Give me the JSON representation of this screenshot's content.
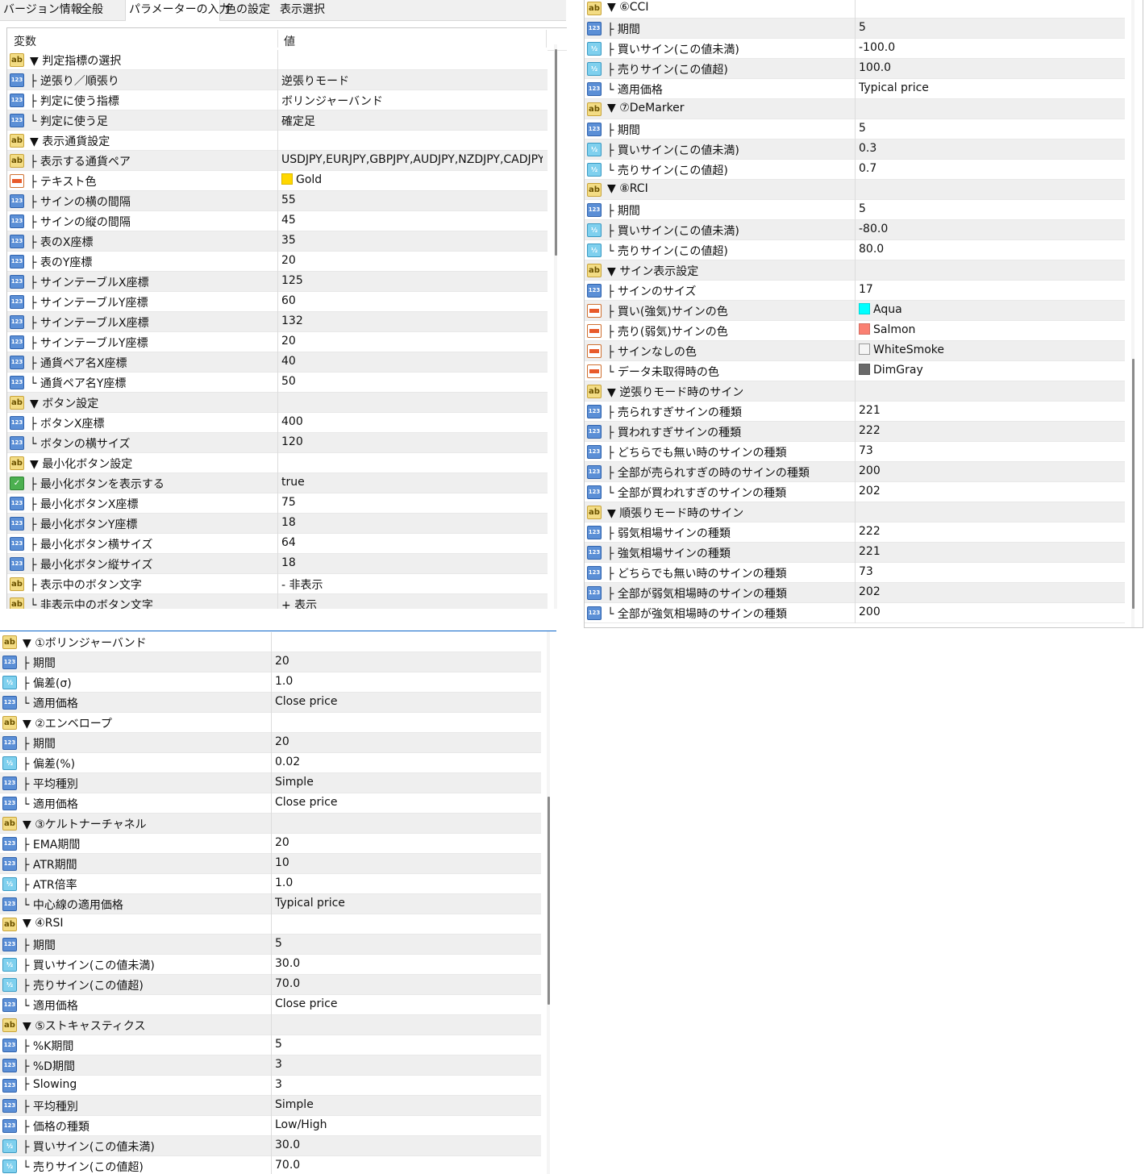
{
  "tabs": [
    {
      "label": "バージョン情報",
      "active": false
    },
    {
      "label": "全般",
      "active": false
    },
    {
      "label": "パラメーターの入力",
      "active": true
    },
    {
      "label": "色の設定",
      "active": false
    },
    {
      "label": "表示選択",
      "active": false
    }
  ],
  "header": {
    "col_name": "変数",
    "col_value": "値"
  },
  "colors": {
    "Gold": "#FFD700",
    "Aqua": "#00FFFF",
    "Salmon": "#FA8072",
    "WhiteSmoke": "#F5F5F5",
    "DimGray": "#696969"
  },
  "panel_top_left": [
    {
      "icon": "ab",
      "name": "▼ 判定指標の選択",
      "value": ""
    },
    {
      "icon": "123",
      "name": "├ 逆張り／順張り",
      "value": "逆張りモード"
    },
    {
      "icon": "123",
      "name": "├ 判定に使う指標",
      "value": "ボリンジャーバンド"
    },
    {
      "icon": "123",
      "name": "└ 判定に使う足",
      "value": "確定足"
    },
    {
      "icon": "ab",
      "name": "▼ 表示通貨設定",
      "value": ""
    },
    {
      "icon": "ab",
      "name": "├ 表示する通貨ペア",
      "value": "USDJPY,EURJPY,GBPJPY,AUDJPY,NZDJPY,CADJPY..."
    },
    {
      "icon": "clr",
      "name": "├ テキスト色",
      "value": "Gold",
      "swatch": "Gold"
    },
    {
      "icon": "123",
      "name": "├ サインの横の間隔",
      "value": "55"
    },
    {
      "icon": "123",
      "name": "├ サインの縦の間隔",
      "value": "45"
    },
    {
      "icon": "123",
      "name": "├ 表のX座標",
      "value": "35"
    },
    {
      "icon": "123",
      "name": "├ 表のY座標",
      "value": "20"
    },
    {
      "icon": "123",
      "name": "├ サインテーブルX座標",
      "value": "125"
    },
    {
      "icon": "123",
      "name": "├ サインテーブルY座標",
      "value": "60"
    },
    {
      "icon": "123",
      "name": "├ サインテーブルX座標",
      "value": "132"
    },
    {
      "icon": "123",
      "name": "├ サインテーブルY座標",
      "value": "20"
    },
    {
      "icon": "123",
      "name": "├ 通貨ペア名X座標",
      "value": "40"
    },
    {
      "icon": "123",
      "name": "└ 通貨ペア名Y座標",
      "value": "50"
    },
    {
      "icon": "ab",
      "name": "▼ ボタン設定",
      "value": ""
    },
    {
      "icon": "123",
      "name": "├ ボタンX座標",
      "value": "400"
    },
    {
      "icon": "123",
      "name": "└ ボタンの横サイズ",
      "value": "120"
    },
    {
      "icon": "ab",
      "name": "▼ 最小化ボタン設定",
      "value": ""
    },
    {
      "icon": "bool",
      "name": "├ 最小化ボタンを表示する",
      "value": "true"
    },
    {
      "icon": "123",
      "name": "├ 最小化ボタンX座標",
      "value": "75"
    },
    {
      "icon": "123",
      "name": "├ 最小化ボタンY座標",
      "value": "18"
    },
    {
      "icon": "123",
      "name": "├ 最小化ボタン横サイズ",
      "value": "64"
    },
    {
      "icon": "123",
      "name": "├ 最小化ボタン縦サイズ",
      "value": "18"
    },
    {
      "icon": "ab",
      "name": "├ 表示中のボタン文字",
      "value": "- 非表示"
    },
    {
      "icon": "ab",
      "name": "└ 非表示中のボタン文字",
      "value": "+ 表示"
    }
  ],
  "panel_bottom_left": [
    {
      "icon": "ab",
      "name": "▼ ①ボリンジャーバンド",
      "value": ""
    },
    {
      "icon": "123",
      "name": "├ 期間",
      "value": "20"
    },
    {
      "icon": "half",
      "name": "├ 偏差(σ)",
      "value": "1.0"
    },
    {
      "icon": "123",
      "name": "└ 適用価格",
      "value": "Close price"
    },
    {
      "icon": "ab",
      "name": "▼ ②エンベロープ",
      "value": ""
    },
    {
      "icon": "123",
      "name": "├ 期間",
      "value": "20"
    },
    {
      "icon": "half",
      "name": "├ 偏差(%)",
      "value": "0.02"
    },
    {
      "icon": "123",
      "name": "├ 平均種別",
      "value": "Simple"
    },
    {
      "icon": "123",
      "name": "└ 適用価格",
      "value": "Close price"
    },
    {
      "icon": "ab",
      "name": "▼ ③ケルトナーチャネル",
      "value": ""
    },
    {
      "icon": "123",
      "name": "├ EMA期間",
      "value": "20"
    },
    {
      "icon": "123",
      "name": "├ ATR期間",
      "value": "10"
    },
    {
      "icon": "half",
      "name": "├ ATR倍率",
      "value": "1.0"
    },
    {
      "icon": "123",
      "name": "└ 中心線の適用価格",
      "value": "Typical price"
    },
    {
      "icon": "ab",
      "name": "▼ ④RSI",
      "value": ""
    },
    {
      "icon": "123",
      "name": "├ 期間",
      "value": "5"
    },
    {
      "icon": "half",
      "name": "├ 買いサイン(この値未満)",
      "value": "30.0"
    },
    {
      "icon": "half",
      "name": "├ 売りサイン(この値超)",
      "value": "70.0"
    },
    {
      "icon": "123",
      "name": "└ 適用価格",
      "value": "Close price"
    },
    {
      "icon": "ab",
      "name": "▼ ⑤ストキャスティクス",
      "value": ""
    },
    {
      "icon": "123",
      "name": "├ %K期間",
      "value": "5"
    },
    {
      "icon": "123",
      "name": "├ %D期間",
      "value": "3"
    },
    {
      "icon": "123",
      "name": "├ Slowing",
      "value": "3"
    },
    {
      "icon": "123",
      "name": "├ 平均種別",
      "value": "Simple"
    },
    {
      "icon": "123",
      "name": "├ 価格の種類",
      "value": "Low/High"
    },
    {
      "icon": "half",
      "name": "├ 買いサイン(この値未満)",
      "value": "30.0"
    },
    {
      "icon": "half",
      "name": "└ 売りサイン(この値超)",
      "value": "70.0"
    }
  ],
  "panel_top_right": [
    {
      "icon": "ab",
      "name": "▼ ⑥CCI",
      "value": ""
    },
    {
      "icon": "123",
      "name": "├ 期間",
      "value": "5"
    },
    {
      "icon": "half",
      "name": "├ 買いサイン(この値未満)",
      "value": "-100.0"
    },
    {
      "icon": "half",
      "name": "├ 売りサイン(この値超)",
      "value": "100.0"
    },
    {
      "icon": "123",
      "name": "└ 適用価格",
      "value": "Typical price"
    },
    {
      "icon": "ab",
      "name": "▼ ⑦DeMarker",
      "value": ""
    },
    {
      "icon": "123",
      "name": "├ 期間",
      "value": "5"
    },
    {
      "icon": "half",
      "name": "├ 買いサイン(この値未満)",
      "value": "0.3"
    },
    {
      "icon": "half",
      "name": "└ 売りサイン(この値超)",
      "value": "0.7"
    },
    {
      "icon": "ab",
      "name": "▼ ⑧RCI",
      "value": ""
    },
    {
      "icon": "123",
      "name": "├ 期間",
      "value": "5"
    },
    {
      "icon": "half",
      "name": "├ 買いサイン(この値未満)",
      "value": "-80.0"
    },
    {
      "icon": "half",
      "name": "└ 売りサイン(この値超)",
      "value": "80.0"
    },
    {
      "icon": "ab",
      "name": "▼ サイン表示設定",
      "value": ""
    },
    {
      "icon": "123",
      "name": "├ サインのサイズ",
      "value": "17"
    },
    {
      "icon": "clr",
      "name": "├ 買い(強気)サインの色",
      "value": "Aqua",
      "swatch": "Aqua"
    },
    {
      "icon": "clr",
      "name": "├ 売り(弱気)サインの色",
      "value": "Salmon",
      "swatch": "Salmon"
    },
    {
      "icon": "clr",
      "name": "├ サインなしの色",
      "value": "WhiteSmoke",
      "swatch": "WhiteSmoke"
    },
    {
      "icon": "clr",
      "name": "└ データ未取得時の色",
      "value": "DimGray",
      "swatch": "DimGray"
    },
    {
      "icon": "ab",
      "name": "▼ 逆張りモード時のサイン",
      "value": ""
    },
    {
      "icon": "123",
      "name": "├ 売られすぎサインの種類",
      "value": "221"
    },
    {
      "icon": "123",
      "name": "├ 買われすぎサインの種類",
      "value": "222"
    },
    {
      "icon": "123",
      "name": "├ どちらでも無い時のサインの種類",
      "value": "73"
    },
    {
      "icon": "123",
      "name": "├ 全部が売られすぎの時のサインの種類",
      "value": "200"
    },
    {
      "icon": "123",
      "name": "└ 全部が買われすぎのサインの種類",
      "value": "202"
    },
    {
      "icon": "ab",
      "name": "▼ 順張りモード時のサイン",
      "value": ""
    },
    {
      "icon": "123",
      "name": "├ 弱気相場サインの種類",
      "value": "222"
    },
    {
      "icon": "123",
      "name": "├ 強気相場サインの種類",
      "value": "221"
    },
    {
      "icon": "123",
      "name": "├ どちらでも無い時のサインの種類",
      "value": "73"
    },
    {
      "icon": "123",
      "name": "├ 全部が弱気相場時のサインの種類",
      "value": "202"
    },
    {
      "icon": "123",
      "name": "└ 全部が強気相場時のサインの種類",
      "value": "200"
    }
  ]
}
